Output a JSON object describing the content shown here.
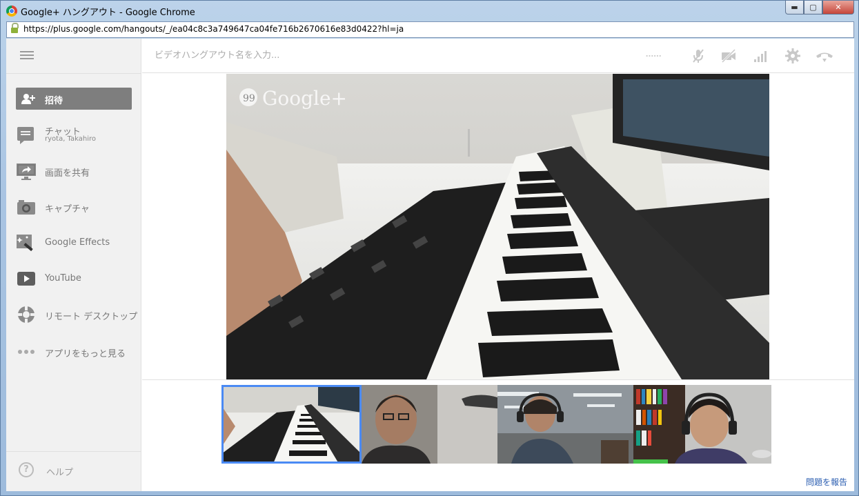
{
  "window": {
    "title": "Google+ ハングアウト - Google Chrome",
    "url": "https://plus.google.com/hangouts/_/ea04c8c3a749647ca04fe716b2670616e83d0422?hl=ja",
    "controls": {
      "minimize": "▬",
      "maximize": "▢",
      "close": "✕"
    }
  },
  "sidebar": {
    "menu_icon": "hamburger-icon",
    "invite": {
      "label": "招待",
      "icon": "add-person-icon"
    },
    "items": [
      {
        "label": "チャット",
        "sub": "ryota, Takahiro",
        "icon": "chat-icon"
      },
      {
        "label": "画面を共有",
        "icon": "screenshare-icon"
      },
      {
        "label": "キャプチャ",
        "icon": "camera-icon"
      },
      {
        "label": "Google Effects",
        "icon": "effects-wand-icon"
      },
      {
        "label": "YouTube",
        "icon": "youtube-icon"
      },
      {
        "label": "リモート デスクトップ",
        "icon": "remote-desktop-icon"
      },
      {
        "label": "アプリをもっと見る",
        "icon": "more-apps-icon"
      }
    ],
    "help": {
      "label": "ヘルプ",
      "icon_glyph": "?"
    }
  },
  "topbar": {
    "name_placeholder": "ビデオハングアウト名を入力...",
    "icons": [
      "dots-icon",
      "mic-muted-icon",
      "camera-off-icon",
      "signal-icon",
      "gear-icon",
      "hangup-icon"
    ]
  },
  "stage": {
    "watermark": "Google+"
  },
  "thumbnails": [
    {
      "name": "keyboard-feed",
      "active": true
    },
    {
      "name": "participant-1",
      "active": false
    },
    {
      "name": "participant-2",
      "active": false
    },
    {
      "name": "participant-3",
      "active": false
    }
  ],
  "footer": {
    "report_link": "問題を報告"
  },
  "colors": {
    "accent": "#4a8af4",
    "sidebar_bg": "#f1f1f1",
    "invite_bg": "#7e7e7e",
    "link": "#2a5db0"
  }
}
